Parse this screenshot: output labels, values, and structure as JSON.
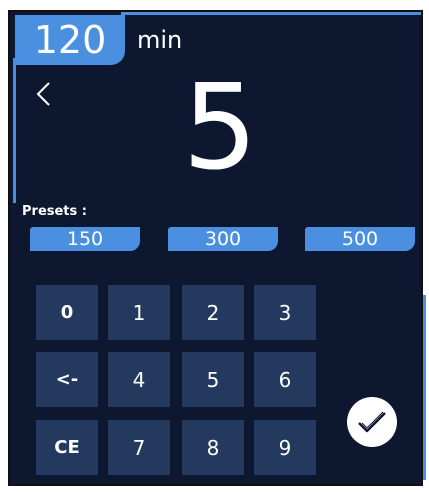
{
  "duration": {
    "value": "120",
    "unit": "min"
  },
  "entry_value": "5",
  "presets": {
    "label": "Presets :",
    "options": [
      "150",
      "300",
      "500"
    ]
  },
  "keypad": {
    "keys": [
      "0",
      "1",
      "2",
      "3",
      "<-",
      "4",
      "5",
      "6",
      "CE",
      "7",
      "8",
      "9"
    ]
  },
  "icons": {
    "back": "chevron-left-icon",
    "confirm": "check-icon"
  },
  "colors": {
    "accent": "#4a8fe0",
    "background": "#0d1830",
    "key": "#233a5e",
    "text": "#ffffff"
  }
}
